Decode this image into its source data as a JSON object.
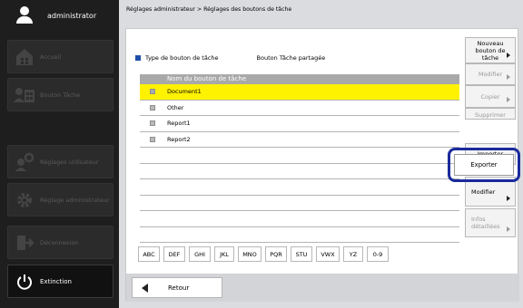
{
  "user": {
    "name": "administrator"
  },
  "sidebar": {
    "items": [
      {
        "label": "Accueil",
        "icon": "home-icon"
      },
      {
        "label": "Bouton Tâche",
        "icon": "task-button-icon"
      },
      {
        "label": "Réglages utilisateur",
        "icon": "user-settings-icon"
      },
      {
        "label": "Réglage administrateur",
        "icon": "gear-icon"
      },
      {
        "label": "Déconnexion",
        "icon": "logout-icon"
      },
      {
        "label": "Extinction",
        "icon": "power-icon"
      }
    ]
  },
  "breadcrumb": "Réglages administrateur > Réglages des boutons de tâche",
  "type_bar": {
    "label": "Type de bouton de tâche",
    "value": "Bouton Tâche partagée"
  },
  "list": {
    "header": "Nom du bouton de tâche",
    "rows": [
      "Document1",
      "Other",
      "Report1",
      "Report2",
      "",
      "",
      "",
      "",
      "",
      ""
    ],
    "selected_index": 0
  },
  "actions": {
    "new": "Nouveau bouton de tâche",
    "modify_top": "Modifier",
    "copy": "Copier",
    "delete": "Supprimer",
    "export": "Exporter",
    "import": "Importer",
    "modify": "Modifier",
    "details": "Infos détaillées"
  },
  "alpha_filters": [
    "ABC",
    "DEF",
    "GHI",
    "JKL",
    "MNO",
    "PQR",
    "STU",
    "VWX",
    "YZ",
    "0-9"
  ],
  "back_button": "Retour",
  "colors": {
    "selected_row": "#fff200",
    "highlight": "#1a2a9c",
    "accent": "#1f4ea8"
  }
}
